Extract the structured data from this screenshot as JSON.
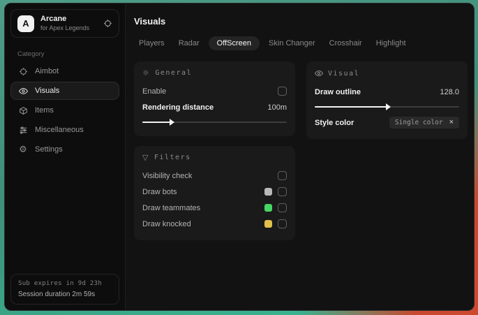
{
  "app": {
    "logo_letter": "A",
    "name": "Arcane",
    "subtitle": "for Apex Legends"
  },
  "sidebar": {
    "category_label": "Category",
    "items": [
      {
        "label": "Aimbot",
        "icon": "crosshair-icon",
        "active": false
      },
      {
        "label": "Visuals",
        "icon": "eye-icon",
        "active": true
      },
      {
        "label": "Items",
        "icon": "box-icon",
        "active": false
      },
      {
        "label": "Miscellaneous",
        "icon": "sliders-icon",
        "active": false
      },
      {
        "label": "Settings",
        "icon": "gear-icon",
        "active": false
      }
    ],
    "footer": {
      "sub_expires": "Sub expires in 9d 23h",
      "session_duration": "Session duration 2m 59s"
    }
  },
  "main": {
    "title": "Visuals",
    "tabs": [
      {
        "label": "Players",
        "active": false
      },
      {
        "label": "Radar",
        "active": false
      },
      {
        "label": "OffScreen",
        "active": true
      },
      {
        "label": "Skin Changer",
        "active": false
      },
      {
        "label": "Crosshair",
        "active": false
      },
      {
        "label": "Highlight",
        "active": false
      }
    ],
    "panels": {
      "general": {
        "title": "General",
        "enable_label": "Enable",
        "enable_checked": false,
        "rendering_distance_label": "Rendering distance",
        "rendering_distance_value": "100m",
        "rendering_distance_percent": 20
      },
      "visual": {
        "title": "Visual",
        "draw_outline_label": "Draw outline",
        "draw_outline_value": "128.0",
        "draw_outline_percent": 50,
        "style_color_label": "Style color",
        "style_color_value": "Single color",
        "style_color_clear": "×"
      },
      "filters": {
        "title": "Filters",
        "rows": [
          {
            "label": "Visibility check",
            "swatch": null,
            "checked": false
          },
          {
            "label": "Draw bots",
            "swatch": "#b8b8b8",
            "checked": false
          },
          {
            "label": "Draw teammates",
            "swatch": "#45d663",
            "checked": false
          },
          {
            "label": "Draw knocked",
            "swatch": "#e2c14a",
            "checked": false
          }
        ]
      }
    }
  },
  "theme": {
    "window_bg": "#121212",
    "sidebar_bg": "#0d0d0d",
    "panel_bg": "#1a1a1a",
    "wallpaper_teal": "#3f8f7a",
    "wallpaper_red": "#cf4a31",
    "slider_fill": "#f2f2f2"
  }
}
